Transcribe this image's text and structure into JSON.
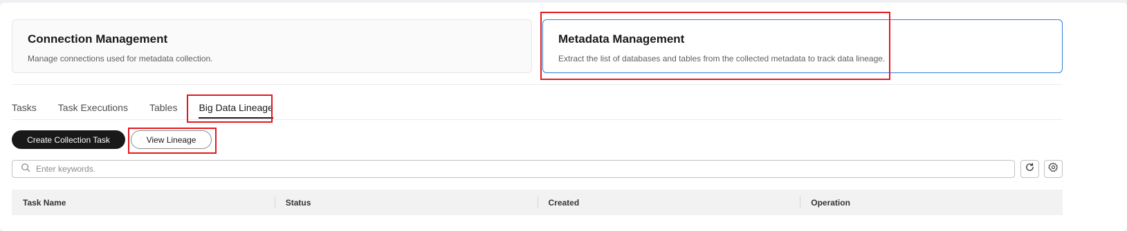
{
  "cards": [
    {
      "title": "Connection Management",
      "description": "Manage connections used for metadata collection."
    },
    {
      "title": "Metadata Management",
      "description": "Extract the list of databases and tables from the collected metadata to track data lineage."
    }
  ],
  "tabs": [
    {
      "label": "Tasks"
    },
    {
      "label": "Task Executions"
    },
    {
      "label": "Tables"
    },
    {
      "label": "Big Data Lineage"
    }
  ],
  "active_tab": "Big Data Lineage",
  "actions": {
    "create_label": "Create Collection Task",
    "view_lineage_label": "View Lineage"
  },
  "search": {
    "placeholder": "Enter keywords.",
    "value": ""
  },
  "toolbar_icons": [
    "refresh-icon",
    "settings-icon"
  ],
  "table": {
    "columns": [
      "Task Name",
      "Status",
      "Created",
      "Operation"
    ]
  },
  "colors": {
    "accent": "#2e7ed6",
    "primary_button": "#191919",
    "highlight": "#e5161b"
  }
}
